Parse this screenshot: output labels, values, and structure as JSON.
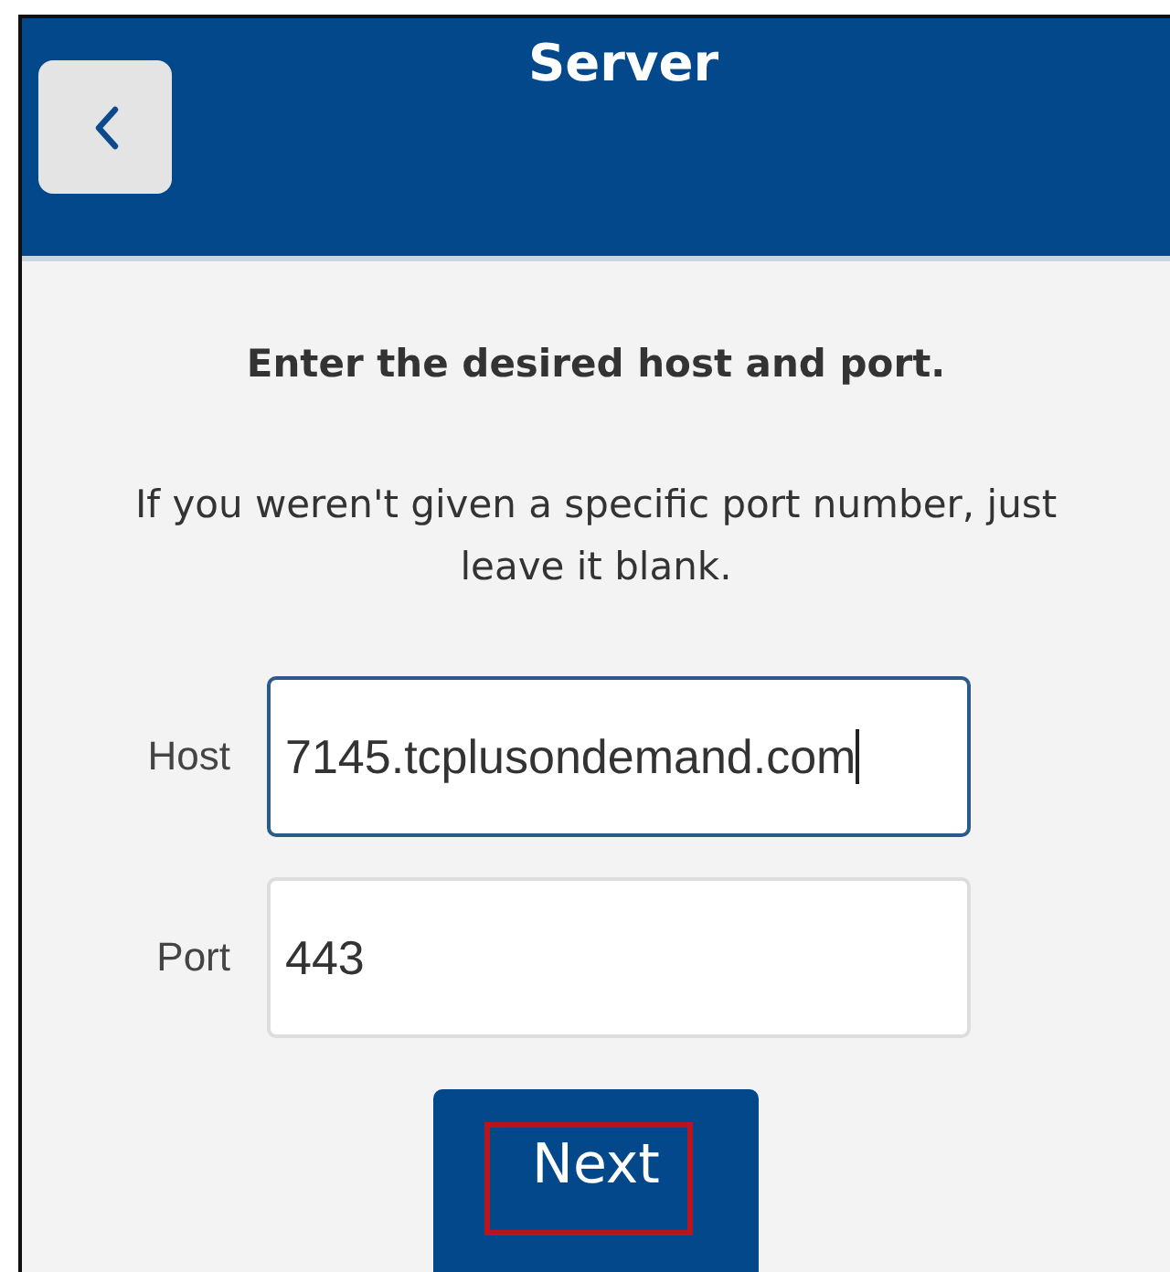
{
  "header": {
    "title": "Server"
  },
  "instructions": {
    "heading": "Enter the desired host and port.",
    "note": "If you weren't given a specific port number, just leave it blank."
  },
  "fields": [
    {
      "label": "Host",
      "value": "7145.tcplusondemand.com",
      "focused": true
    },
    {
      "label": "Port",
      "value": "443",
      "focused": false
    }
  ],
  "next_button": {
    "label": "Next",
    "highlighted": true
  }
}
